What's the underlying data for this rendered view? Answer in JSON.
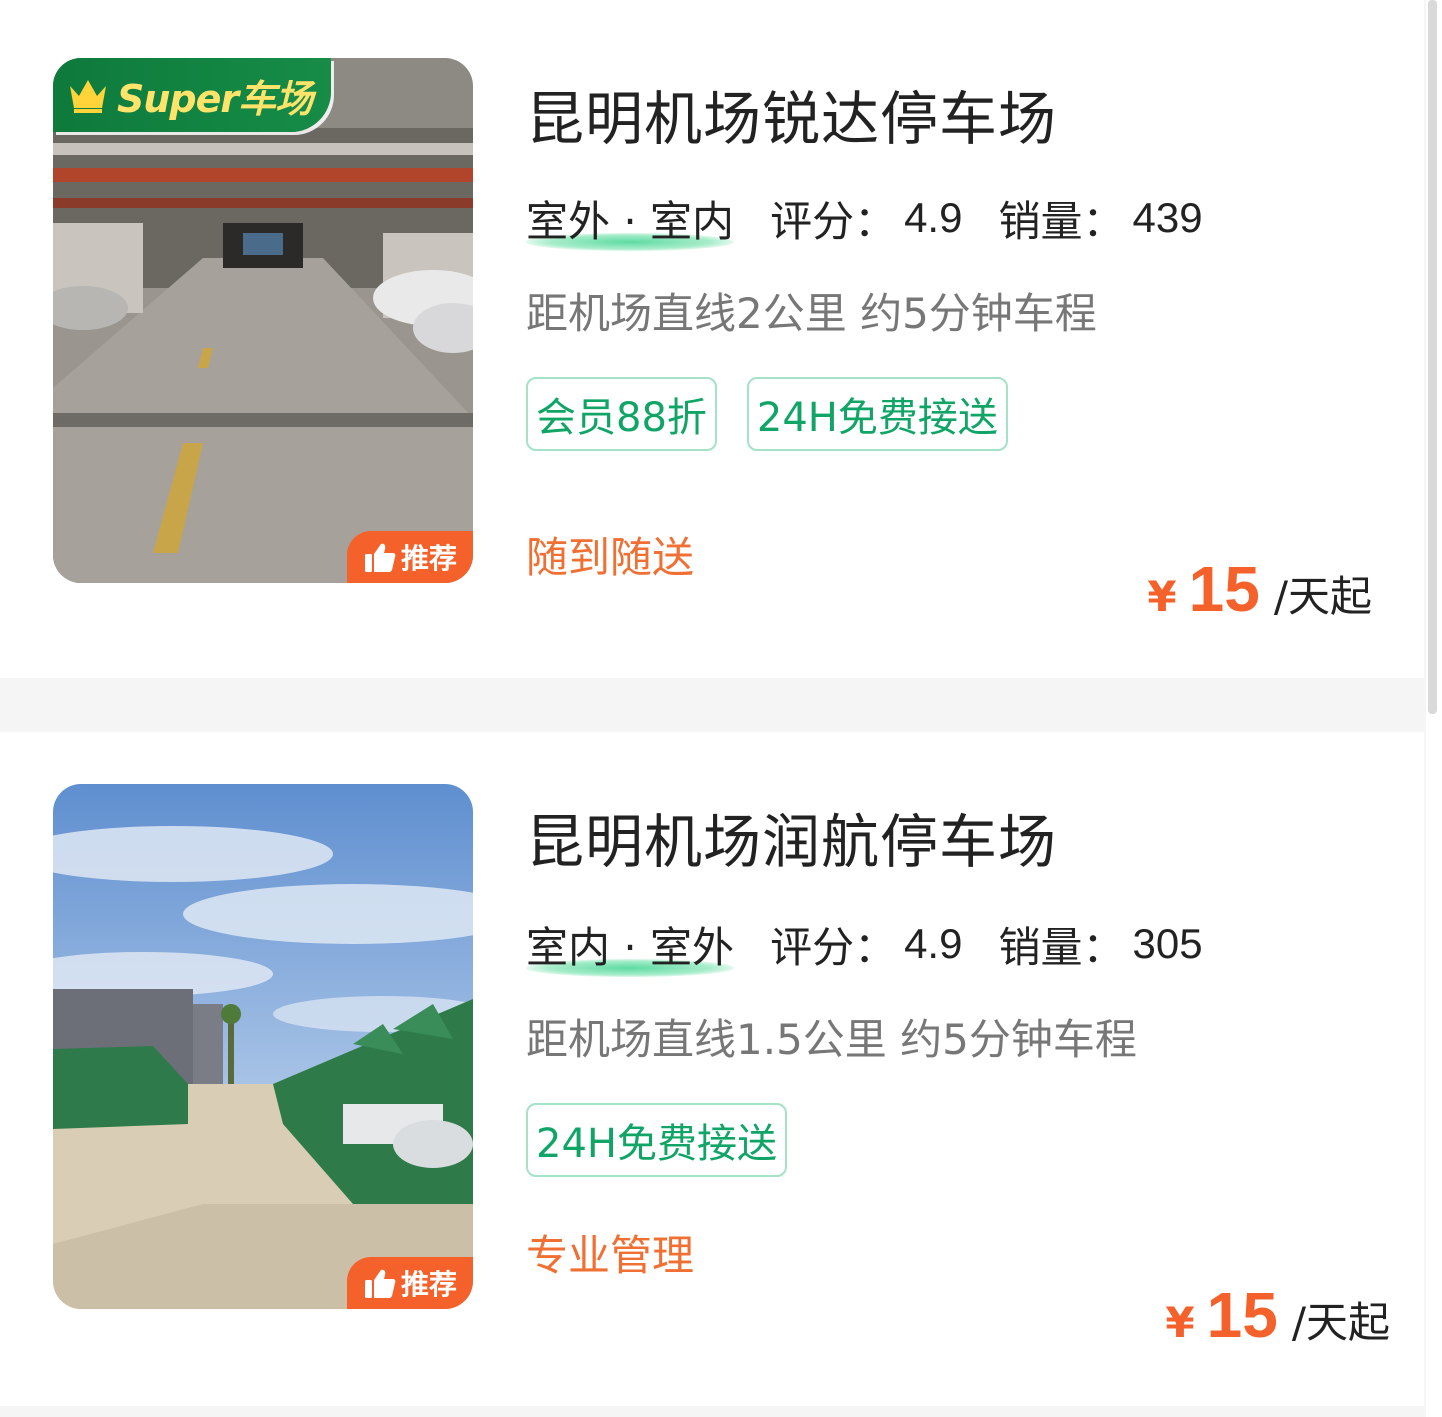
{
  "listings": [
    {
      "name": "昆明机场锐达停车场",
      "type": "室外 · 室内",
      "rating_label": "评分：",
      "rating": "4.9",
      "sales_label": "销量：",
      "sales": "439",
      "distance": "距机场直线2公里 约5分钟车程",
      "tags": [
        "会员88折",
        "24H免费接送"
      ],
      "service": "随到随送",
      "price": {
        "currency": "¥",
        "amount": "15",
        "unit": "/天起"
      },
      "badge_super": "Super车场",
      "badge_recommend": "推荐"
    },
    {
      "name": "昆明机场润航停车场",
      "type": "室内 · 室外",
      "rating_label": "评分：",
      "rating": "4.9",
      "sales_label": "销量：",
      "sales": "305",
      "distance": "距机场直线1.5公里 约5分钟车程",
      "tags": [
        "24H免费接送"
      ],
      "service": "专业管理",
      "price": {
        "currency": "¥",
        "amount": "15",
        "unit": "/天起"
      },
      "badge_recommend": "推荐"
    }
  ],
  "icons": {
    "crown": "crown-icon",
    "thumb": "thumbs-up-icon"
  },
  "colors": {
    "accent_orange": "#f4612b",
    "tag_green": "#10a567",
    "badge_green": "#0e7a3c"
  }
}
